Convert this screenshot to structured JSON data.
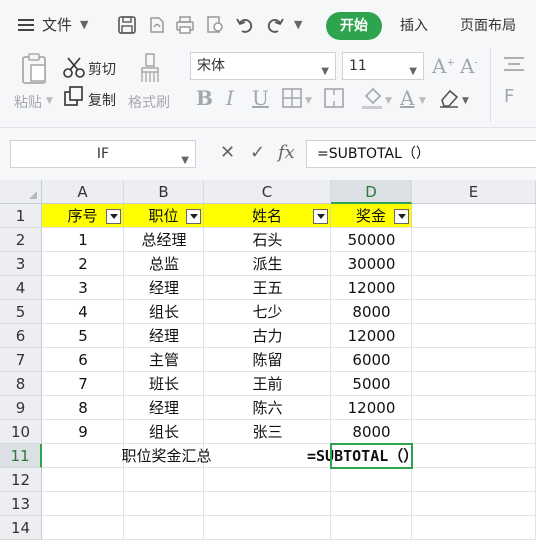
{
  "menu": {
    "file_label": "文件"
  },
  "tabs": {
    "active": "开始",
    "insert": "插入",
    "page_layout": "页面布局"
  },
  "clipboard": {
    "paste": "粘贴",
    "cut": "剪切",
    "copy": "复制",
    "format_painter": "格式刷"
  },
  "font": {
    "family": "宋体",
    "size": "11"
  },
  "formula_bar": {
    "name_box": "IF",
    "fx": "fx",
    "formula": "=SUBTOTAL（）"
  },
  "columns": [
    "A",
    "B",
    "C",
    "D",
    "E"
  ],
  "selected_column": "D",
  "rows": [
    "1",
    "2",
    "3",
    "4",
    "5",
    "6",
    "7",
    "8",
    "9",
    "10",
    "11",
    "12",
    "13",
    "14"
  ],
  "table": {
    "headers": [
      "序号",
      "职位",
      "姓名",
      "奖金"
    ],
    "data": [
      [
        "1",
        "总经理",
        "石头",
        "50000"
      ],
      [
        "2",
        "总监",
        "派生",
        "30000"
      ],
      [
        "3",
        "经理",
        "王五",
        "12000"
      ],
      [
        "4",
        "组长",
        "七少",
        "8000"
      ],
      [
        "5",
        "经理",
        "古力",
        "12000"
      ],
      [
        "6",
        "主管",
        "陈留",
        "6000"
      ],
      [
        "7",
        "班长",
        "王前",
        "5000"
      ],
      [
        "8",
        "经理",
        "陈六",
        "12000"
      ],
      [
        "9",
        "组长",
        "张三",
        "8000"
      ]
    ],
    "summary_label": "职位奖金汇总",
    "summary_formula": "=SUBTOTAL（）"
  },
  "colors": {
    "accent": "#2ea44f",
    "header_fill": "#ffff00"
  }
}
